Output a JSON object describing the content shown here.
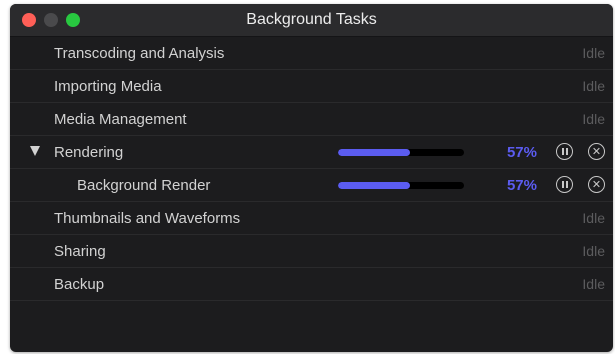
{
  "window": {
    "title": "Background Tasks",
    "traffic_lights": {
      "close": "#ff5f57",
      "minimize": "#4a4a4c",
      "zoom": "#28c840"
    }
  },
  "colors": {
    "accent": "#5b5cf0",
    "idle_text": "#5c5c5e"
  },
  "icons": {
    "disclosure": "disclosure-triangle-icon",
    "pause": "pause-icon",
    "cancel": "close-icon"
  },
  "tasks": [
    {
      "label": "Transcoding and Analysis",
      "status": "Idle"
    },
    {
      "label": "Importing Media",
      "status": "Idle"
    },
    {
      "label": "Media Management",
      "status": "Idle"
    },
    {
      "label": "Rendering",
      "percent_label": "57%",
      "progress": 0.57,
      "expanded": true
    },
    {
      "label": "Background Render",
      "percent_label": "57%",
      "progress": 0.57
    },
    {
      "label": "Thumbnails and Waveforms",
      "status": "Idle"
    },
    {
      "label": "Sharing",
      "status": "Idle"
    },
    {
      "label": "Backup",
      "status": "Idle"
    }
  ]
}
